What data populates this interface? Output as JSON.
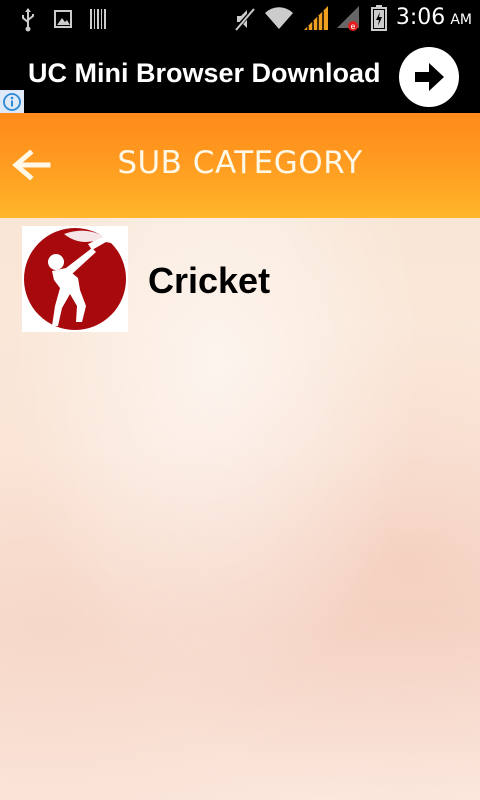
{
  "status_bar": {
    "time": "3:06",
    "ampm": "AM",
    "icons": [
      "usb-icon",
      "image-notification-icon",
      "barcode-icon",
      "mute-icon",
      "wifi-icon",
      "signal-icon",
      "signal-roaming-icon",
      "battery-charging-icon"
    ]
  },
  "ad": {
    "text": "UC Mini Browser Download",
    "info_icon": "info-icon",
    "action_icon": "arrow-right-icon"
  },
  "toolbar": {
    "back_icon": "arrow-left-icon",
    "title": "SUB CATEGORY"
  },
  "list": {
    "items": [
      {
        "label": "Cricket",
        "icon": "cricket-batsman-icon"
      }
    ]
  },
  "colors": {
    "toolbar_orange": "#ff9a20",
    "icon_red": "#a8090c",
    "signal_orange": "#f0a020",
    "roaming_red": "#e02020"
  }
}
